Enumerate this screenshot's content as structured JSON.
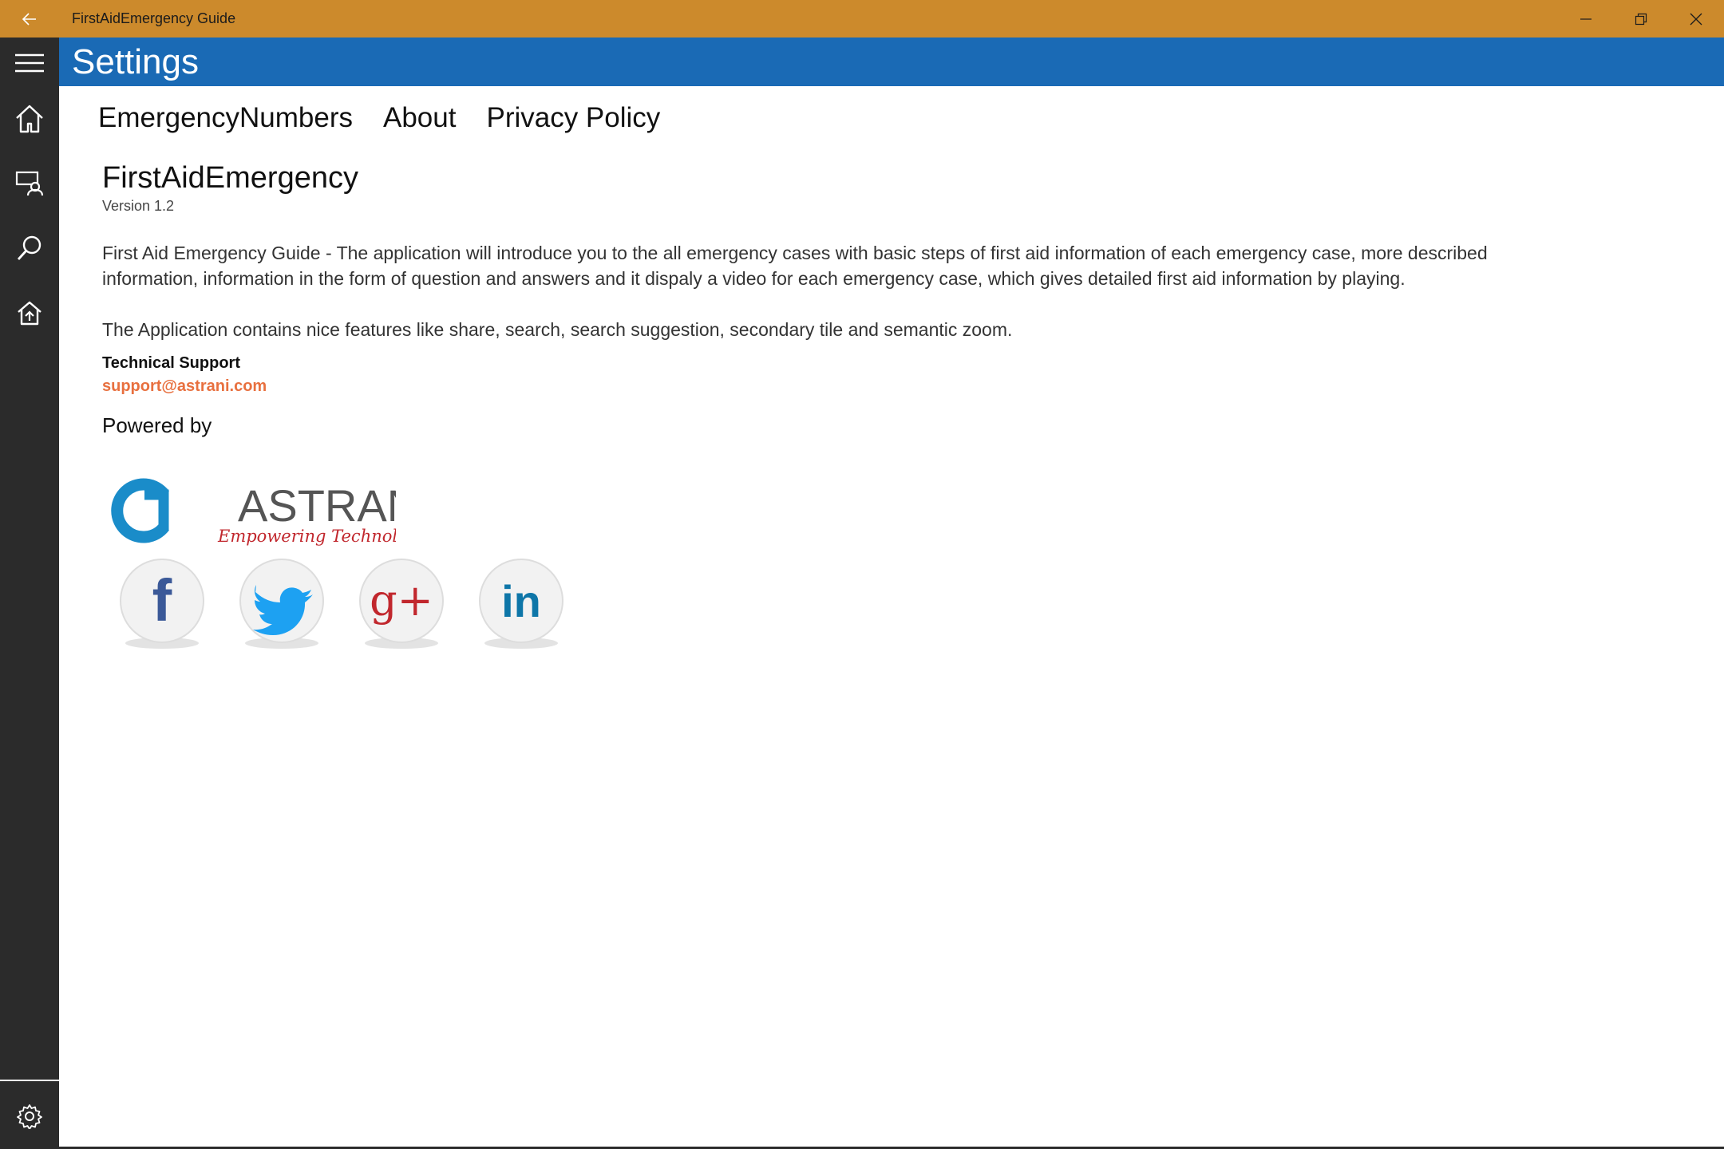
{
  "titlebar": {
    "title": "FirstAidEmergency Guide",
    "back_icon": "back-arrow-icon",
    "controls": [
      "minimize-icon",
      "restore-icon",
      "close-icon"
    ],
    "color": "#cc8a2c"
  },
  "header": {
    "title": "Settings",
    "color": "#1a6ab5"
  },
  "sidebar": {
    "items": [
      "hamburger-menu-icon",
      "home-icon",
      "user-list-icon",
      "search-icon",
      "pin-home-icon"
    ],
    "footer": "settings-gear-icon",
    "color": "#2b2b2b"
  },
  "tabs": [
    "EmergencyNumbers",
    "About",
    "Privacy Policy"
  ],
  "about": {
    "app_name": "FirstAidEmergency",
    "version": "Version 1.2",
    "description": "First Aid Emergency Guide - The application will introduce you to the all emergency cases with basic steps of first aid information of each emergency case, more described information, information in the form of question and answers and it dispaly a video for each emergency case, which gives detailed first aid information by playing.",
    "features": "The Application contains nice features like share, search, search suggestion, secondary tile and semantic zoom.",
    "support_label": "Technical Support",
    "support_email": "support@astrani.com",
    "powered_by": "Powered by"
  },
  "logo": {
    "name": "ASTRANI",
    "tagline": "Empowering Technologies"
  },
  "social": [
    {
      "icon": "facebook-icon",
      "glyph": "f",
      "color": "#3b5998"
    },
    {
      "icon": "twitter-icon",
      "glyph": "",
      "color": "#1da1f2"
    },
    {
      "icon": "google-plus-icon",
      "glyph": "g+",
      "color": "#c1272d"
    },
    {
      "icon": "linkedin-icon",
      "glyph": "in",
      "color": "#0e76a8"
    }
  ]
}
